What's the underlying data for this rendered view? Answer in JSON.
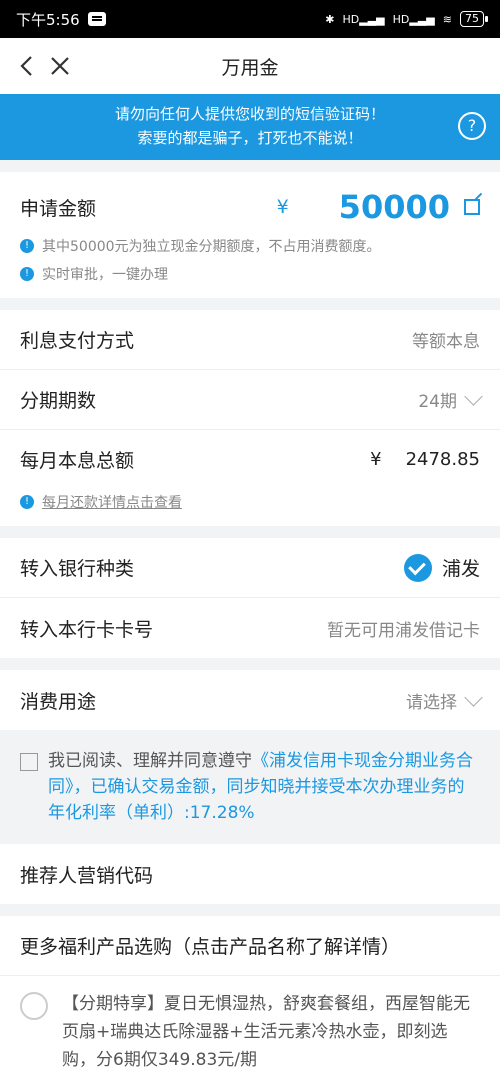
{
  "status": {
    "time": "下午5:56",
    "battery": "75",
    "hd1": "HD",
    "hd2": "HD"
  },
  "nav": {
    "title": "万用金"
  },
  "banner": {
    "line1": "请勿向任何人提供您收到的短信验证码！",
    "line2": "索要的都是骗子，打死也不能说！",
    "help": "?"
  },
  "amount": {
    "label": "申请金额",
    "currency": "¥",
    "value": "50000",
    "note1": "其中50000元为独立现金分期额度，不占用消费额度。",
    "note2": "实时审批，一键办理"
  },
  "rows": {
    "interest_label": "利息支付方式",
    "interest_value": "等额本息",
    "period_label": "分期期数",
    "period_value": "24期",
    "monthly_label": "每月本息总额",
    "monthly_currency": "¥",
    "monthly_value": "2478.85",
    "monthly_link": "每月还款详情点击查看",
    "bank_label": "转入银行种类",
    "bank_value": "浦发",
    "card_label": "转入本行卡卡号",
    "card_value": "暂无可用浦发借记卡",
    "purpose_label": "消费用途",
    "purpose_value": "请选择"
  },
  "agreement": {
    "prefix": "我已阅读、理解并同意遵守",
    "contract": "《浦发信用卡现金分期业务合同》",
    "suffix": "，已确认交易金额，同步知晓并接受本次办理业务的年化利率（单利）:17.28%"
  },
  "referral": {
    "label": "推荐人营销代码"
  },
  "more": {
    "label": "更多福利产品选购（点击产品名称了解详情）"
  },
  "product": {
    "text": "【分期特享】夏日无惧湿热，舒爽套餐组，西屋智能无页扇+瑞典达氏除湿器+生活元素冷热水壶，即刻选购，分6期仅349.83元/期"
  },
  "colors": {
    "accent": "#1b98e0"
  }
}
